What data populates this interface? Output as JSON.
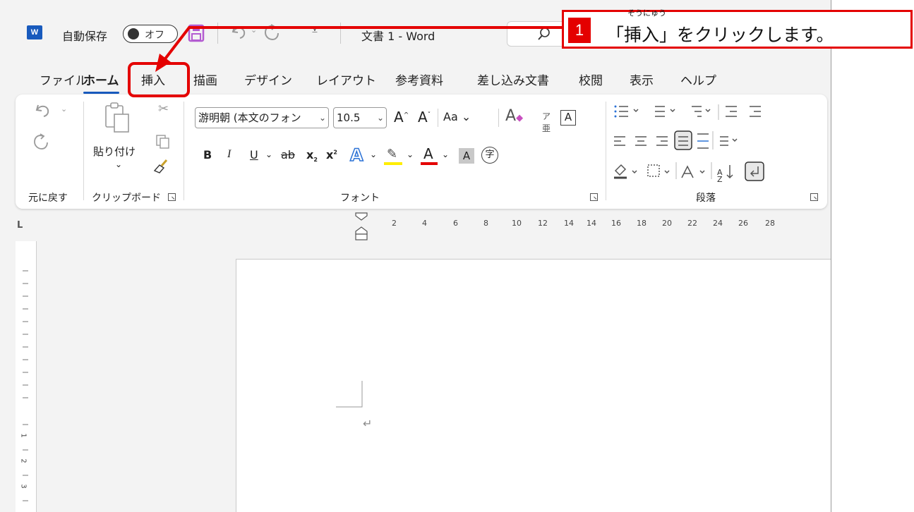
{
  "title_bar": {
    "app_icon": "word-logo-icon",
    "app_icon_letter": "W",
    "autosave_label": "自動保存",
    "autosave_state": "オフ",
    "save_icon": "save-icon",
    "undo_icon": "undo-icon",
    "redo_icon": "redo-icon",
    "customize_icon": "customize-toolbar-icon",
    "document_title": "文書 1  -  Word",
    "search_icon": "search-icon"
  },
  "tabs": [
    {
      "label": "ファイル",
      "active": false
    },
    {
      "label": "ホーム",
      "active": true
    },
    {
      "label": "挿入",
      "active": false
    },
    {
      "label": "描画",
      "active": false
    },
    {
      "label": "デザイン",
      "active": false
    },
    {
      "label": "レイアウト",
      "active": false
    },
    {
      "label": "参考資料",
      "active": false
    },
    {
      "label": "差し込み文書",
      "active": false
    },
    {
      "label": "校閲",
      "active": false
    },
    {
      "label": "表示",
      "active": false
    },
    {
      "label": "ヘルプ",
      "active": false
    }
  ],
  "ribbon": {
    "undo_group": {
      "label": "元に戻す"
    },
    "clipboard_group": {
      "label": "クリップボード",
      "paste_label": "貼り付け"
    },
    "font_group": {
      "label": "フォント",
      "font_name": "游明朝 (本文のフォン",
      "font_size": "10.5",
      "grow_label": "A",
      "shrink_label": "A",
      "case_label": "Aa",
      "bold": "B",
      "italic": "I",
      "underline": "U",
      "strike": "ab",
      "subscript": "x",
      "superscript": "x",
      "effects": "A",
      "font_color": "A",
      "char_shading": "A",
      "enclose": "字"
    },
    "paragraph_group": {
      "label": "段落"
    }
  },
  "ruler": {
    "corner": "L",
    "ticks": [
      "2",
      "4",
      "6",
      "8",
      "10",
      "12",
      "14",
      "16",
      "18",
      "20",
      "22",
      "24",
      "26",
      "28"
    ],
    "vertical_numbers": [
      "1",
      "2",
      "3"
    ]
  },
  "document": {
    "paragraph_mark": "↵"
  },
  "callout": {
    "step_number": "1",
    "text": "「挿入」をクリックします。",
    "ruby": "そうにゅう"
  },
  "colors": {
    "accent": "#185abd",
    "highlight": "#e40000",
    "save_icon": "#b35bd1"
  }
}
